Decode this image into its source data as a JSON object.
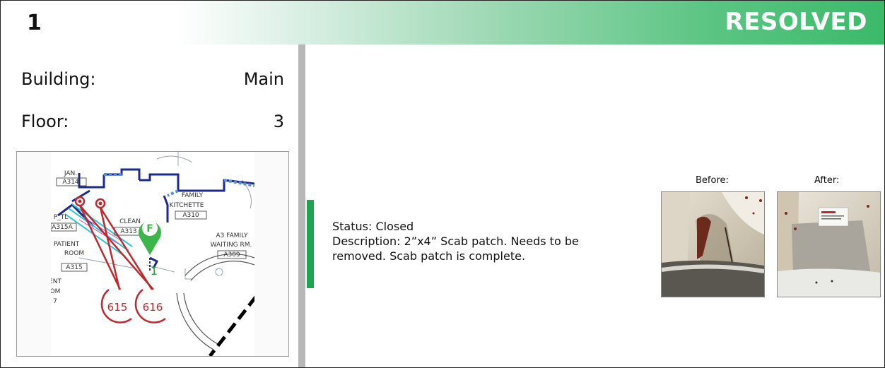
{
  "header": {
    "issue_number": "1",
    "status_title": "RESOLVED",
    "accent_color": "#3cb96a"
  },
  "location": {
    "building_label": "Building:",
    "building_value": "Main",
    "floor_label": "Floor:",
    "floor_value": "3"
  },
  "floor_plan": {
    "rooms": [
      {
        "name": "JAN.",
        "number": "A314"
      },
      {
        "name": "FAMILY",
        "name2": "KITCHETTE",
        "number": "A310"
      },
      {
        "name": "CLEAN",
        "number": "A313"
      },
      {
        "name": "P_TL",
        "number": "A315A"
      },
      {
        "name": "PATIENT",
        "name2": "ROOM",
        "number": "A315"
      },
      {
        "name": "A3 FAMILY",
        "name2": "WAITING RM.",
        "number": "A309"
      },
      {
        "name": "ENT",
        "name2": "OM",
        "number": "7"
      }
    ],
    "pin_letter": "F",
    "pin_number": "1",
    "callouts": [
      "615",
      "616"
    ],
    "pin_color": "#3cb54a",
    "callout_color": "#c0282d"
  },
  "details": {
    "status": "Status: Closed",
    "description": "Description: 2”x4” Scab patch. Needs to be removed. Scab patch is complete."
  },
  "photos": {
    "before_label": "Before:",
    "after_label": "After:"
  }
}
